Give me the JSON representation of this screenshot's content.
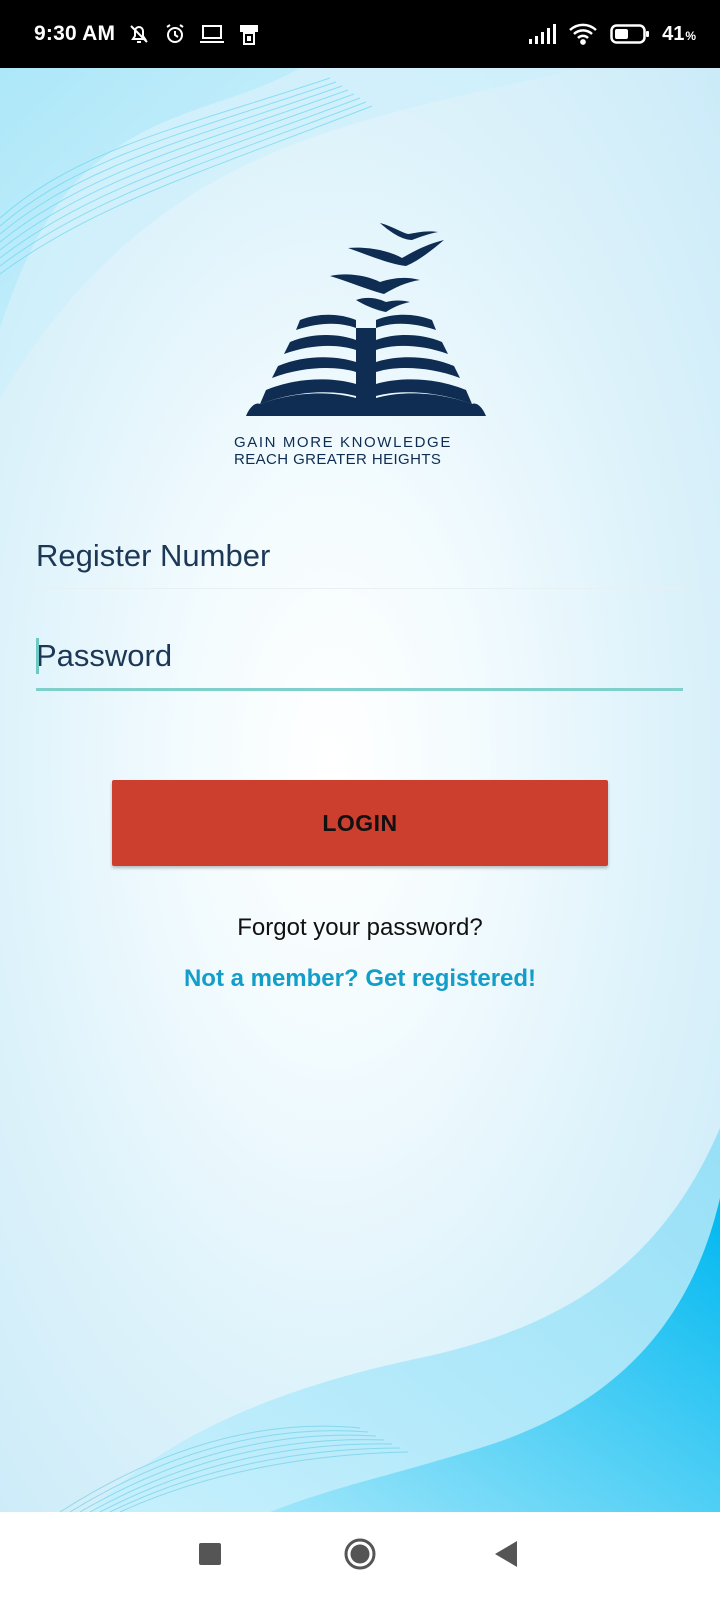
{
  "status_bar": {
    "time": "9:30 AM",
    "battery_percent": "41",
    "battery_unit": "%",
    "icons": [
      "mute-bell-icon",
      "alarm-icon",
      "laptop-icon",
      "nfc-phone-icon",
      "signal-icon",
      "wifi-icon",
      "battery-icon"
    ]
  },
  "logo": {
    "tagline_line1": "GAIN  MORE  KNOWLEDGE",
    "tagline_line2": "REACH GREATER HEIGHTS",
    "color": "#0f2d52"
  },
  "form": {
    "register_number_placeholder": "Register Number",
    "password_placeholder": "Password",
    "login_label": "LOGIN",
    "forgot_password_label": "Forgot your password?",
    "register_link_label": "Not a member? Get registered!"
  },
  "colors": {
    "login_button": "#cc3e2e",
    "link": "#139ec9",
    "focused_underline": "#7fcfcb",
    "wave_accent": "#00b8f0"
  },
  "nav_bar": {
    "buttons": [
      "recents-icon",
      "home-icon",
      "back-icon"
    ]
  }
}
